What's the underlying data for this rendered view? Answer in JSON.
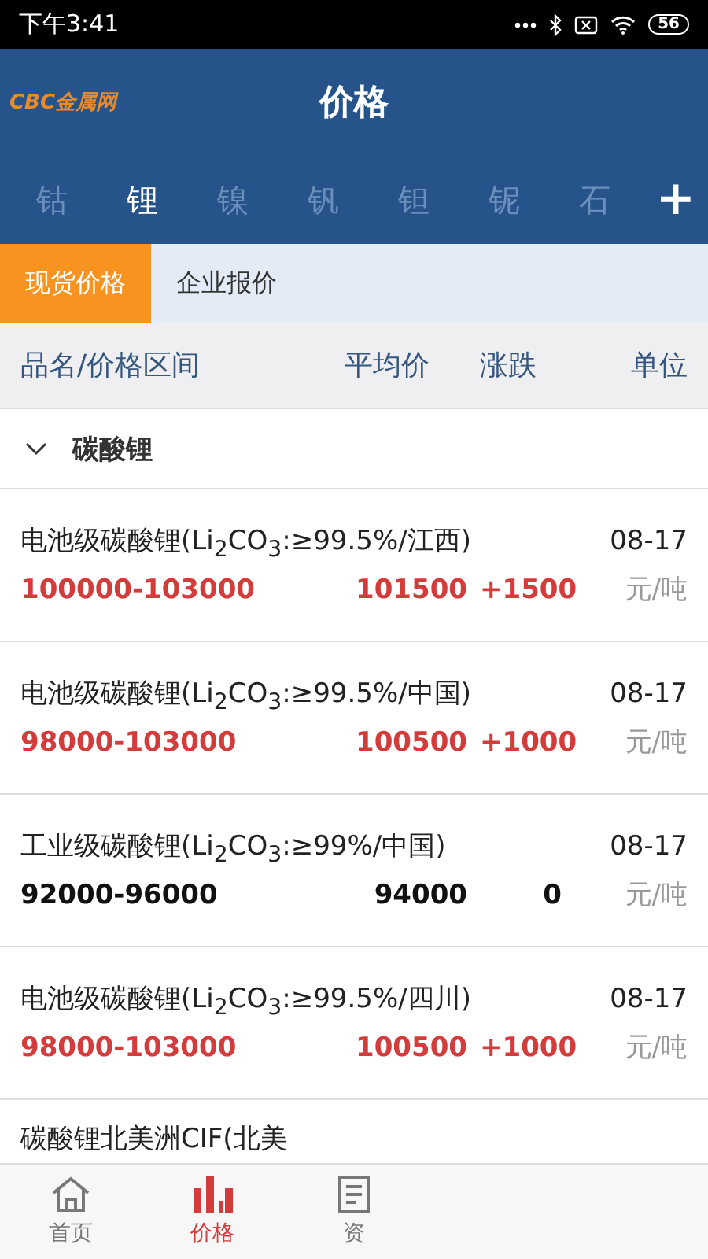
{
  "status_bar": {
    "time": "下午3:41",
    "battery": "56"
  },
  "header": {
    "logo": "CBC金属网",
    "title": "价格"
  },
  "metal_tabs": [
    {
      "label": "钴",
      "selected": false
    },
    {
      "label": "锂",
      "selected": true
    },
    {
      "label": "镍",
      "selected": false
    },
    {
      "label": "钒",
      "selected": false
    },
    {
      "label": "钽",
      "selected": false
    },
    {
      "label": "铌",
      "selected": false
    },
    {
      "label": "石",
      "selected": false
    }
  ],
  "add_button": "+",
  "sub_tabs": [
    {
      "label": "现货价格",
      "selected": true
    },
    {
      "label": "企业报价",
      "selected": false
    }
  ],
  "table": {
    "columns": [
      "品名/价格区间",
      "平均价",
      "涨跌",
      "单位"
    ],
    "group": {
      "name": "碳酸锂",
      "expanded": true
    },
    "rows": [
      {
        "name": "电池级碳酸锂(Li$_{2}$CO$_{3}$:≥99.5%/江西)",
        "date": "08-17",
        "range": "100000-103000",
        "average": "101500",
        "change": "+1500",
        "unit": "元/吨",
        "kind": "up"
      },
      {
        "name": "电池级碳酸锂(Li$_{2}$CO$_{3}$:≥99.5%/中国)",
        "date": "08-17",
        "range": "98000-103000",
        "average": "100500",
        "change": "+1000",
        "unit": "元/吨",
        "kind": "up"
      },
      {
        "name": "工业级碳酸锂(Li$_{2}$CO$_{3}$:≥99%/中国)",
        "date": "08-17",
        "range": "92000-96000",
        "average": "94000",
        "change": "0",
        "unit": "元/吨",
        "kind": "flat"
      },
      {
        "name": "电池级碳酸锂(Li$_{2}$CO$_{3}$:≥99.5%/四川)",
        "date": "08-17",
        "range": "98000-103000",
        "average": "100500",
        "change": "+1000",
        "unit": "元/吨",
        "kind": "up"
      }
    ],
    "partial_row": "碳酸锂北美洲CIF(北美"
  },
  "bottom_nav": [
    {
      "label": "首页",
      "kind": "home",
      "selected": false
    },
    {
      "label": "价格",
      "kind": "chart",
      "selected": true
    },
    {
      "label": "资",
      "kind": "doc",
      "selected": false
    }
  ]
}
